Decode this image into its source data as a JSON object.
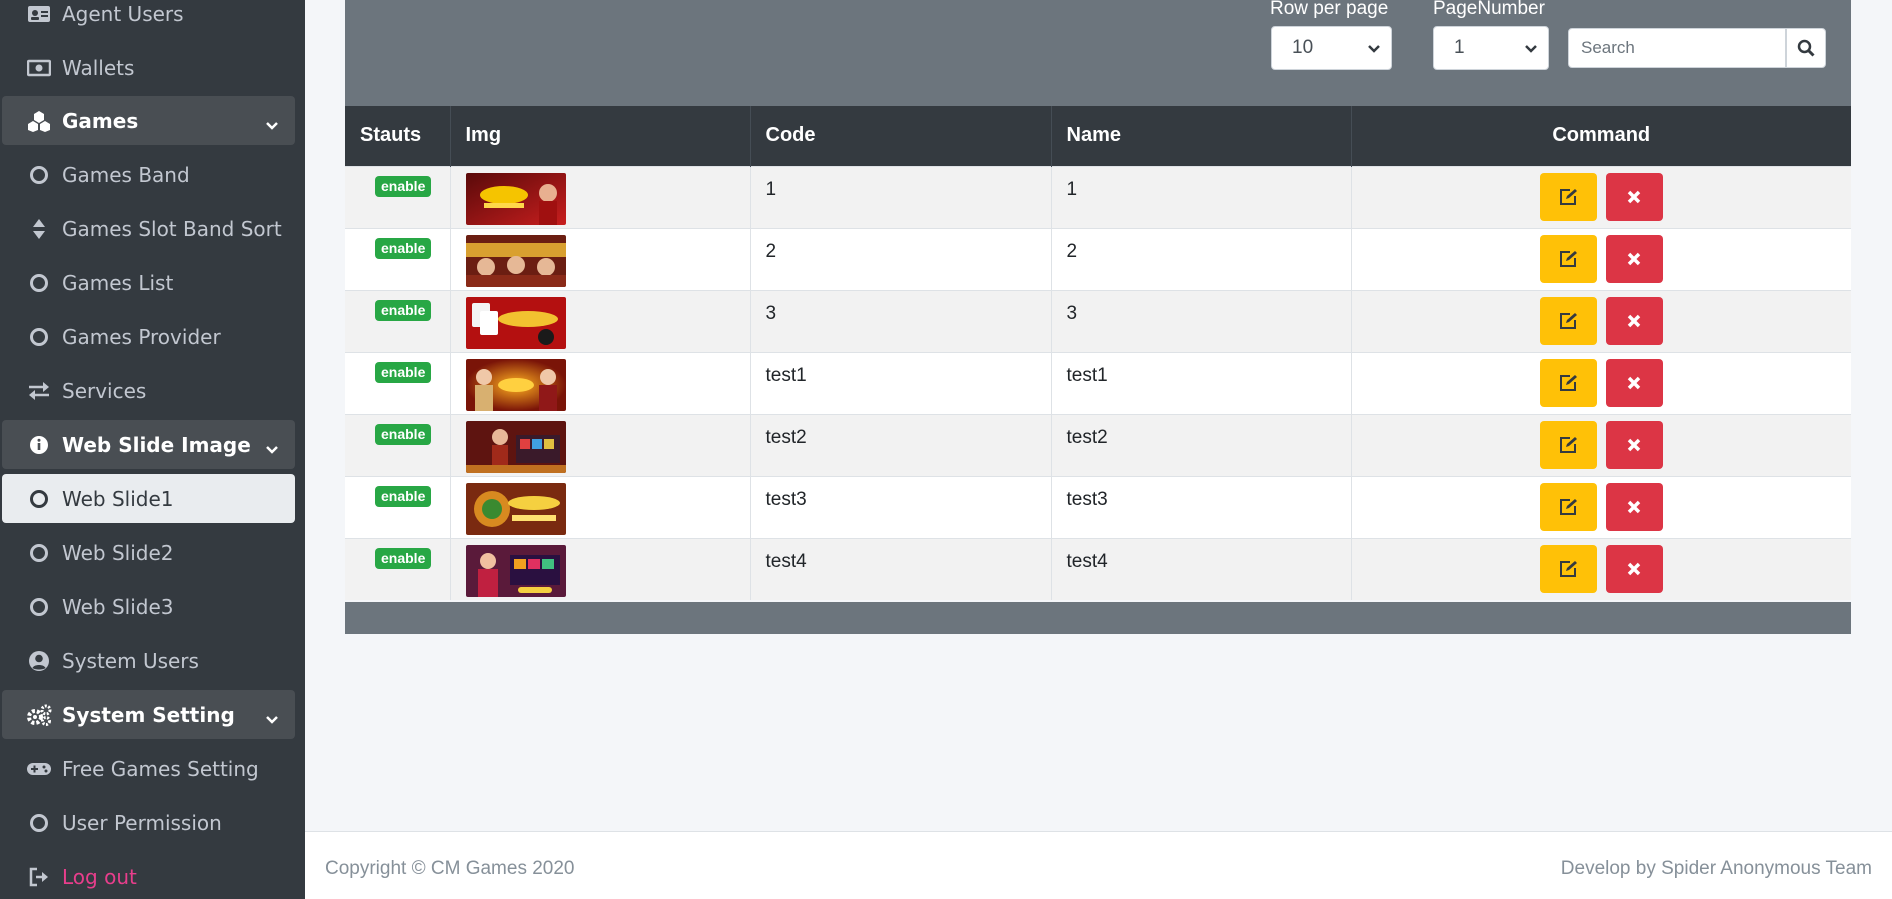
{
  "sidebar": {
    "items": [
      {
        "label": "Agent Users",
        "icon": "id-card-icon"
      },
      {
        "label": "Wallets",
        "icon": "money-bill-icon"
      },
      {
        "label": "Games",
        "icon": "cubes-icon",
        "type": "header"
      },
      {
        "label": "Games Band",
        "icon": "circle-icon"
      },
      {
        "label": "Games Slot Band Sort",
        "icon": "sort-icon"
      },
      {
        "label": "Games List",
        "icon": "circle-icon"
      },
      {
        "label": "Games Provider",
        "icon": "circle-icon"
      },
      {
        "label": "Services",
        "icon": "exchange-icon"
      },
      {
        "label": "Web Slide Image",
        "icon": "info-circle-icon",
        "type": "header"
      },
      {
        "label": "Web Slide1",
        "icon": "circle-icon",
        "active": true
      },
      {
        "label": "Web Slide2",
        "icon": "circle-icon"
      },
      {
        "label": "Web Slide3",
        "icon": "circle-icon"
      },
      {
        "label": "System Users",
        "icon": "user-circle-icon"
      },
      {
        "label": "System Setting",
        "icon": "cogs-icon",
        "type": "header"
      },
      {
        "label": "Free Games Setting",
        "icon": "gamepad-icon"
      },
      {
        "label": "User Permission",
        "icon": "circle-icon"
      },
      {
        "label": "Log out",
        "icon": "sign-out-icon"
      }
    ]
  },
  "controls": {
    "row_per_page_label": "Row per page",
    "row_per_page_value": "10",
    "page_number_label": "PageNumber",
    "page_number_value": "1",
    "search_placeholder": "Search"
  },
  "table": {
    "headers": [
      "Stauts",
      "Img",
      "Code",
      "Name",
      "Command"
    ],
    "rows": [
      {
        "status": "enable",
        "code": "1",
        "name": "1"
      },
      {
        "status": "enable",
        "code": "2",
        "name": "2"
      },
      {
        "status": "enable",
        "code": "3",
        "name": "3"
      },
      {
        "status": "enable",
        "code": "test1",
        "name": "test1"
      },
      {
        "status": "enable",
        "code": "test2",
        "name": "test2"
      },
      {
        "status": "enable",
        "code": "test3",
        "name": "test3"
      },
      {
        "status": "enable",
        "code": "test4",
        "name": "test4"
      }
    ]
  },
  "footer": {
    "copyright": "Copyright © CM Games 2020",
    "developer": "Develop by Spider Anonymous Team"
  },
  "colors": {
    "sidebar_bg": "#343a40",
    "header_item_bg": "#494e53",
    "active_item_bg": "#e9ecef",
    "table_head_bg": "#343a40",
    "card_header_bg": "#6c757d",
    "badge_green": "#28a745",
    "edit_yellow": "#ffc107",
    "delete_red": "#dc3545",
    "logout_pink": "#e83e8c"
  }
}
